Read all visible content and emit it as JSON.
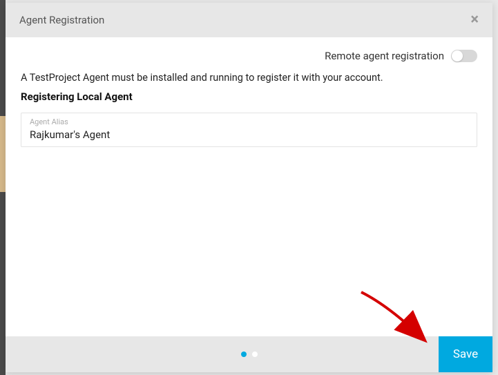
{
  "modal": {
    "title": "Agent Registration",
    "close_symbol": "×"
  },
  "remote": {
    "label": "Remote agent registration",
    "enabled": false
  },
  "info_text": "A TestProject Agent must be installed and running to register it with your account.",
  "section_title": "Registering Local Agent",
  "agent_alias": {
    "label": "Agent Alias",
    "value": "Rajkumar's Agent"
  },
  "pagination": {
    "total": 2,
    "active": 1
  },
  "footer": {
    "save_label": "Save"
  }
}
